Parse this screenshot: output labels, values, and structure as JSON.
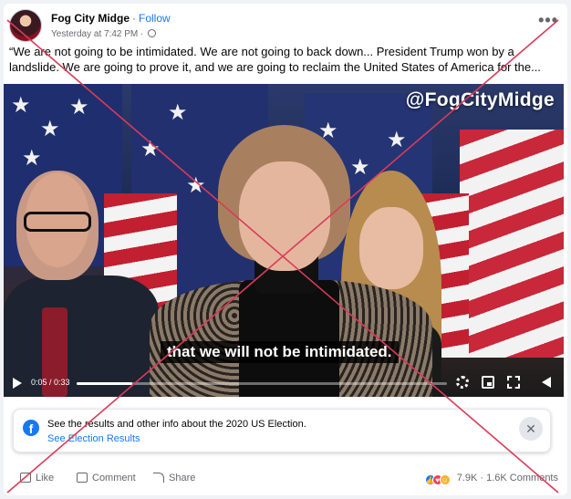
{
  "header": {
    "page_name": "Fog City Midge",
    "separator": "·",
    "follow_label": "Follow",
    "timestamp": "Yesterday at 7:42 PM",
    "meta_separator": "·",
    "more_label": "•••"
  },
  "post": {
    "text": "“We are not going to be intimidated. We are not going to back down... President Trump won by a landslide. We are going to prove it, and we are going to reclaim the United States of America for the..."
  },
  "video": {
    "watermark": "@FogCityMidge",
    "caption": "that we will not be intimidated.",
    "time": "0:05 / 0:33",
    "progress": 0.15
  },
  "info": {
    "text": "See the results and other info about the 2020 US Election.",
    "link": "See Election Results",
    "close_label": "✕",
    "brand_letter": "f"
  },
  "actions": {
    "like": "Like",
    "comment": "Comment",
    "share": "Share",
    "reaction_count": "7.9K",
    "comment_count": "1.6K Comments",
    "separator": "·"
  },
  "colors": {
    "accent": "#1877f2",
    "cross": "#d93b5a"
  }
}
